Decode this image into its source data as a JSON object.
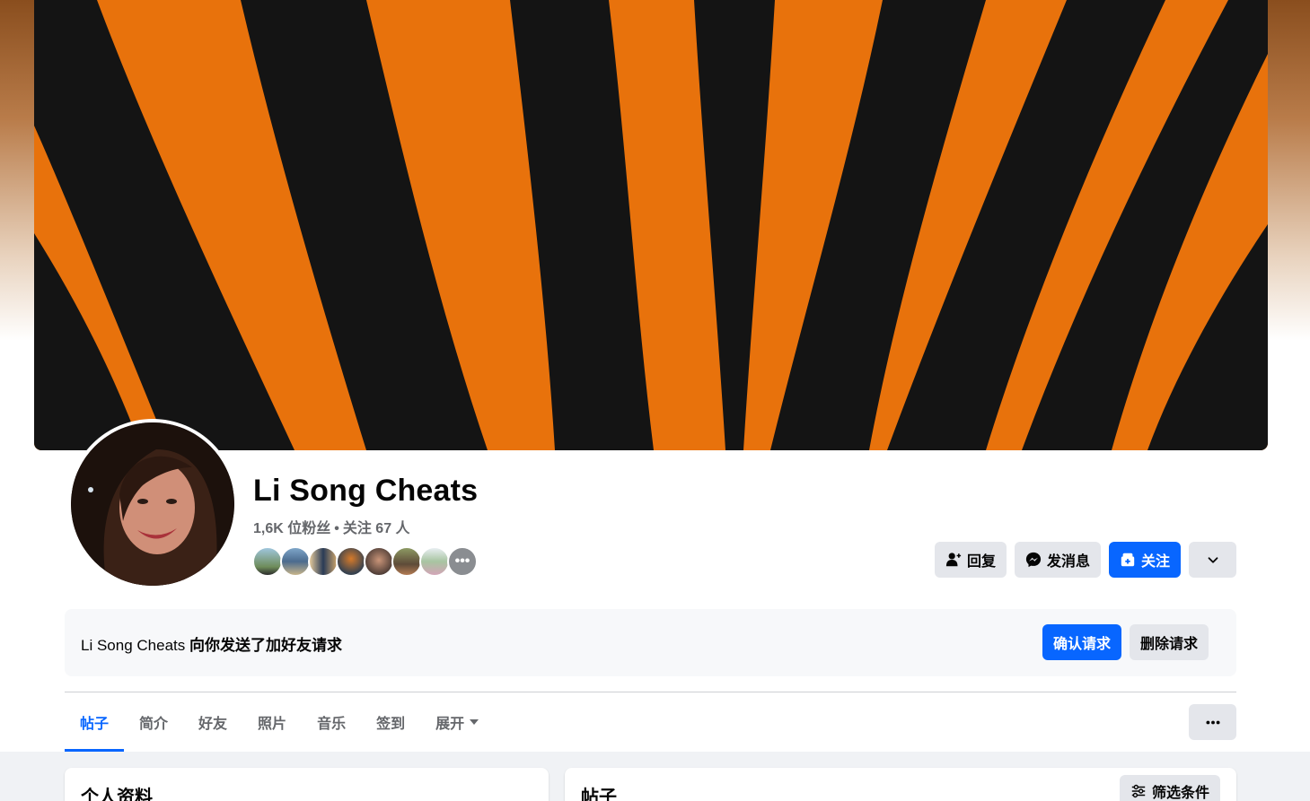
{
  "profile": {
    "name": "Li Song Cheats",
    "followers": "1,6K 位粉丝",
    "following": "关注 67 人",
    "separator": "•"
  },
  "actions": {
    "reply": "回复",
    "message": "发消息",
    "follow": "关注"
  },
  "friend_request": {
    "sender": "Li Song Cheats",
    "text": " 向你发送了加好友请求",
    "confirm": "确认请求",
    "delete": "删除请求"
  },
  "tabs": [
    {
      "label": "帖子"
    },
    {
      "label": "简介"
    },
    {
      "label": "好友"
    },
    {
      "label": "照片"
    },
    {
      "label": "音乐"
    },
    {
      "label": "签到"
    },
    {
      "label": "展开"
    }
  ],
  "sections": {
    "about_title": "个人资料",
    "posts_title": "帖子",
    "filter": "筛选条件"
  },
  "followers_more": "•••",
  "colors": {
    "accent": "#0866ff",
    "button_grey": "#e4e6eb",
    "cover_orange": "#e8720c",
    "cover_black": "#141414"
  },
  "icons": {
    "reply": "person-icon",
    "message": "messenger-icon",
    "follow": "follow-icon",
    "dropdown": "chevron-down-icon",
    "more": "ellipsis-icon",
    "filter": "sliders-icon"
  }
}
